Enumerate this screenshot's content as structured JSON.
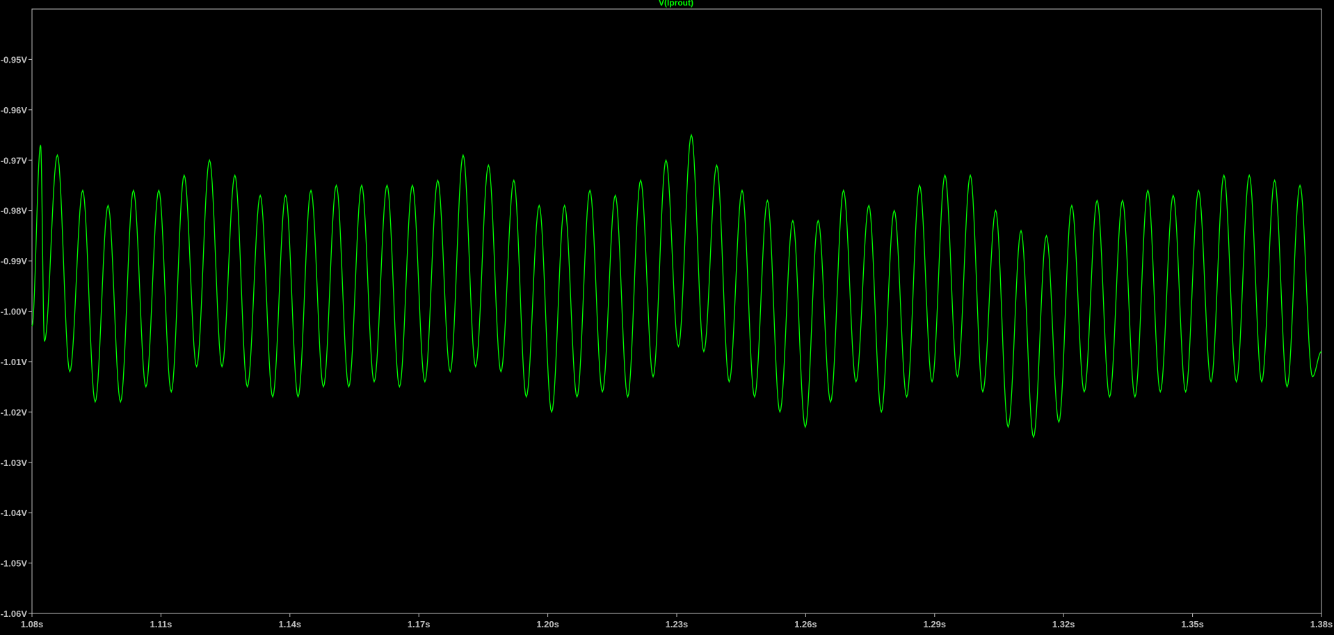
{
  "colors": {
    "background": "#000000",
    "axes": "#c0c0c0",
    "text": "#c0c0c0",
    "trace": "#00ff00"
  },
  "chart_data": {
    "type": "line",
    "title": "V(lprout)",
    "xlabel": "",
    "ylabel": "",
    "grid": false,
    "xlim": [
      1.08,
      1.38
    ],
    "ylim": [
      -1.06,
      -0.94
    ],
    "x_ticks": [
      {
        "value": 1.08,
        "label": "1.08s"
      },
      {
        "value": 1.11,
        "label": "1.11s"
      },
      {
        "value": 1.14,
        "label": "1.14s"
      },
      {
        "value": 1.17,
        "label": "1.17s"
      },
      {
        "value": 1.2,
        "label": "1.20s"
      },
      {
        "value": 1.23,
        "label": "1.23s"
      },
      {
        "value": 1.26,
        "label": "1.26s"
      },
      {
        "value": 1.29,
        "label": "1.29s"
      },
      {
        "value": 1.32,
        "label": "1.32s"
      },
      {
        "value": 1.35,
        "label": "1.35s"
      },
      {
        "value": 1.38,
        "label": "1.38s"
      }
    ],
    "y_ticks": [
      {
        "value": -0.95,
        "label": "-0.95V"
      },
      {
        "value": -0.96,
        "label": "-0.96V"
      },
      {
        "value": -0.97,
        "label": "-0.97V"
      },
      {
        "value": -0.98,
        "label": "-0.98V"
      },
      {
        "value": -0.99,
        "label": "-0.99V"
      },
      {
        "value": -1.0,
        "label": "-1.00V"
      },
      {
        "value": -1.01,
        "label": "-1.01V"
      },
      {
        "value": -1.02,
        "label": "-1.02V"
      },
      {
        "value": -1.03,
        "label": "-1.03V"
      },
      {
        "value": -1.04,
        "label": "-1.04V"
      },
      {
        "value": -1.05,
        "label": "-1.05V"
      },
      {
        "value": -1.06,
        "label": "-1.06V"
      }
    ],
    "series": [
      {
        "name": "V(lprout)",
        "x": [
          1.08,
          1.082,
          1.0829,
          1.0859,
          1.0888,
          1.0918,
          1.0947,
          1.0977,
          1.1006,
          1.1036,
          1.1065,
          1.1095,
          1.1124,
          1.1154,
          1.1183,
          1.1213,
          1.1242,
          1.1272,
          1.1301,
          1.1331,
          1.136,
          1.139,
          1.1419,
          1.1449,
          1.1478,
          1.1508,
          1.1537,
          1.1567,
          1.1596,
          1.1626,
          1.1655,
          1.1685,
          1.1714,
          1.1744,
          1.1773,
          1.1803,
          1.1832,
          1.1862,
          1.1891,
          1.1921,
          1.195,
          1.198,
          1.2009,
          1.2039,
          1.2068,
          1.2098,
          1.2127,
          1.2157,
          1.2186,
          1.2216,
          1.2245,
          1.2275,
          1.2304,
          1.2334,
          1.2363,
          1.2393,
          1.2422,
          1.2452,
          1.2481,
          1.2511,
          1.254,
          1.257,
          1.2599,
          1.2629,
          1.2658,
          1.2688,
          1.2717,
          1.2747,
          1.2776,
          1.2806,
          1.2835,
          1.2865,
          1.2894,
          1.2924,
          1.2953,
          1.2983,
          1.3012,
          1.3042,
          1.3071,
          1.3101,
          1.313,
          1.316,
          1.3189,
          1.3219,
          1.3248,
          1.3278,
          1.3307,
          1.3337,
          1.3366,
          1.3396,
          1.3425,
          1.3455,
          1.3484,
          1.3514,
          1.3543,
          1.3573,
          1.3602,
          1.3632,
          1.3661,
          1.3691,
          1.372,
          1.375,
          1.3779,
          1.38
        ],
        "y": [
          -1.003,
          -0.967,
          -1.006,
          -0.969,
          -1.012,
          -0.976,
          -1.018,
          -0.979,
          -1.018,
          -0.976,
          -1.015,
          -0.976,
          -1.016,
          -0.973,
          -1.011,
          -0.97,
          -1.011,
          -0.973,
          -1.015,
          -0.977,
          -1.017,
          -0.977,
          -1.017,
          -0.976,
          -1.015,
          -0.975,
          -1.015,
          -0.975,
          -1.014,
          -0.975,
          -1.015,
          -0.975,
          -1.014,
          -0.974,
          -1.012,
          -0.969,
          -1.011,
          -0.971,
          -1.012,
          -0.974,
          -1.017,
          -0.979,
          -1.02,
          -0.979,
          -1.017,
          -0.976,
          -1.016,
          -0.977,
          -1.017,
          -0.974,
          -1.013,
          -0.97,
          -1.007,
          -0.965,
          -1.008,
          -0.971,
          -1.014,
          -0.976,
          -1.017,
          -0.978,
          -1.02,
          -0.982,
          -1.023,
          -0.982,
          -1.018,
          -0.976,
          -1.014,
          -0.979,
          -1.02,
          -0.98,
          -1.017,
          -0.975,
          -1.014,
          -0.973,
          -1.013,
          -0.973,
          -1.016,
          -0.98,
          -1.023,
          -0.984,
          -1.025,
          -0.985,
          -1.022,
          -0.979,
          -1.016,
          -0.978,
          -1.017,
          -0.978,
          -1.017,
          -0.976,
          -1.016,
          -0.977,
          -1.016,
          -0.976,
          -1.014,
          -0.973,
          -1.014,
          -0.973,
          -1.014,
          -0.974,
          -1.015,
          -0.975,
          -1.013,
          -1.008
        ]
      }
    ]
  }
}
